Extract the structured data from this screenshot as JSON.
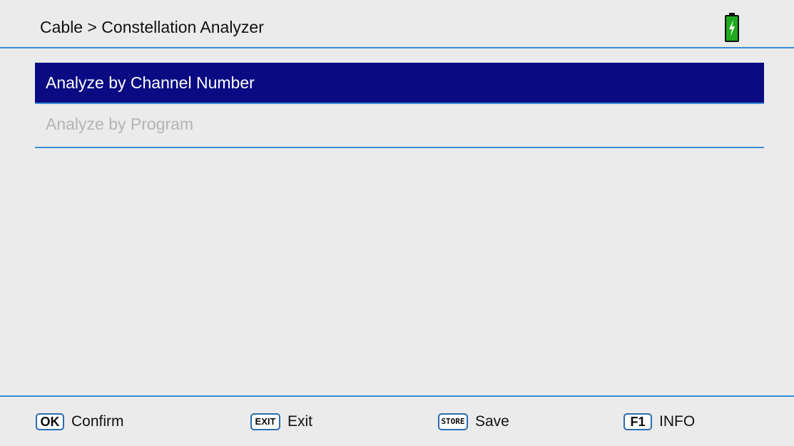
{
  "header": {
    "breadcrumb": "Cable > Constellation Analyzer",
    "battery_icon": "battery-charging-icon",
    "battery_color": "#1faa1f"
  },
  "menu": {
    "items": [
      {
        "label": "Analyze by Channel Number",
        "state": "selected"
      },
      {
        "label": "Analyze by Program",
        "state": "disabled"
      }
    ],
    "selected_color": "#0a0a82",
    "disabled_text_color": "#b4b4b4"
  },
  "footer": {
    "hints": [
      {
        "key": "OK",
        "label": "Confirm"
      },
      {
        "key": "EXIT",
        "label": "Exit"
      },
      {
        "key": "STORE",
        "label": "Save"
      },
      {
        "key": "F1",
        "label": "INFO"
      }
    ]
  },
  "accent_color": "#3a8ed6"
}
